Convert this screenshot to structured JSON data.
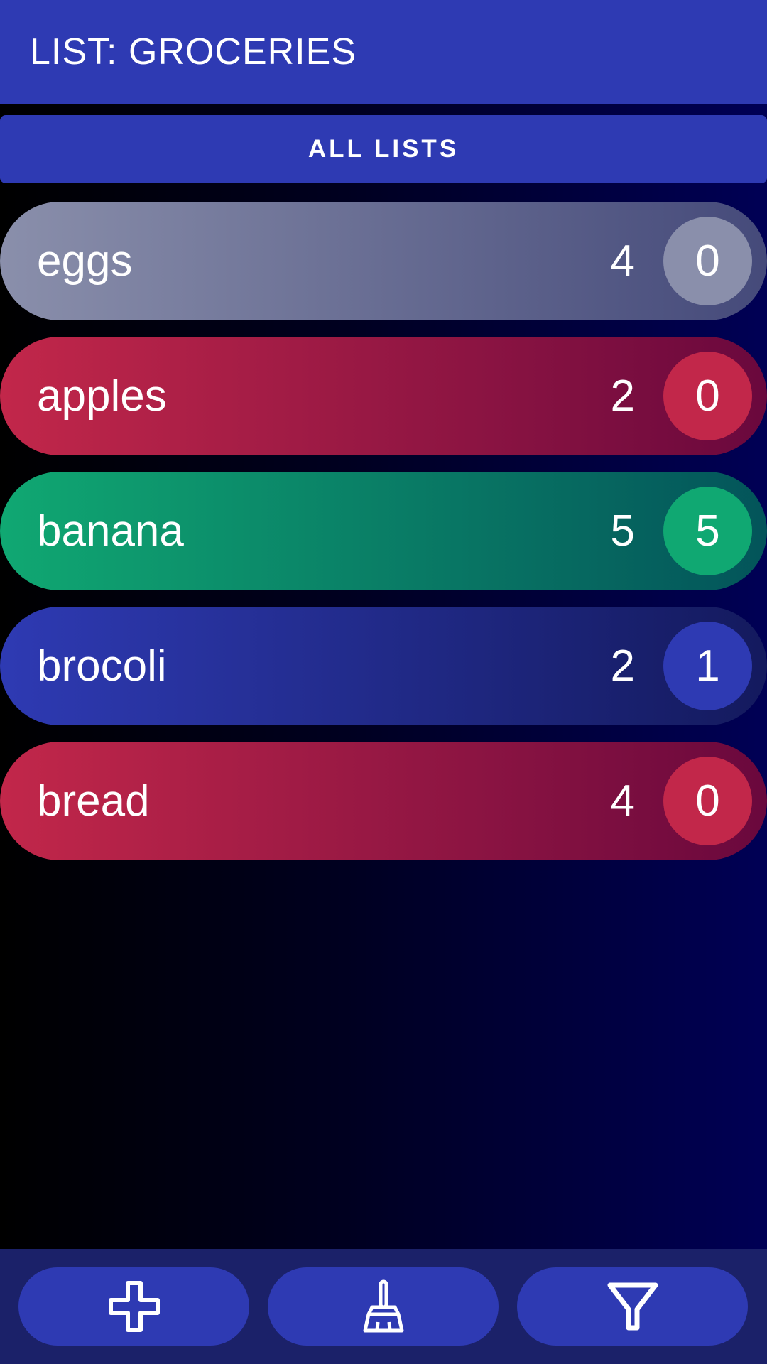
{
  "header": {
    "title": "LIST: GROCERIES"
  },
  "all_lists_button": {
    "label": "ALL LISTS"
  },
  "items": [
    {
      "name": "eggs",
      "quantity": "4",
      "checked": "0",
      "color_from": "#8a8fab",
      "color_to": "#454a7a",
      "badge_color": "#8a8fab"
    },
    {
      "name": "apples",
      "quantity": "2",
      "checked": "0",
      "color_from": "#c2274a",
      "color_to": "#6a083d",
      "badge_color": "#c2274a"
    },
    {
      "name": "banana",
      "quantity": "5",
      "checked": "5",
      "color_from": "#10a872",
      "color_to": "#03545a",
      "badge_color": "#10a872"
    },
    {
      "name": "brocoli",
      "quantity": "2",
      "checked": "1",
      "color_from": "#2e3ab3",
      "color_to": "#141a5e",
      "badge_color": "#2e3ab3"
    },
    {
      "name": "bread",
      "quantity": "4",
      "checked": "0",
      "color_from": "#c2274a",
      "color_to": "#6a083d",
      "badge_color": "#c2274a"
    }
  ],
  "bottom_bar": {
    "buttons": [
      {
        "icon": "plus-icon"
      },
      {
        "icon": "broom-icon"
      },
      {
        "icon": "filter-icon"
      }
    ]
  },
  "colors": {
    "primary": "#2e3ab3",
    "bottom_bar": "#1b2169"
  }
}
